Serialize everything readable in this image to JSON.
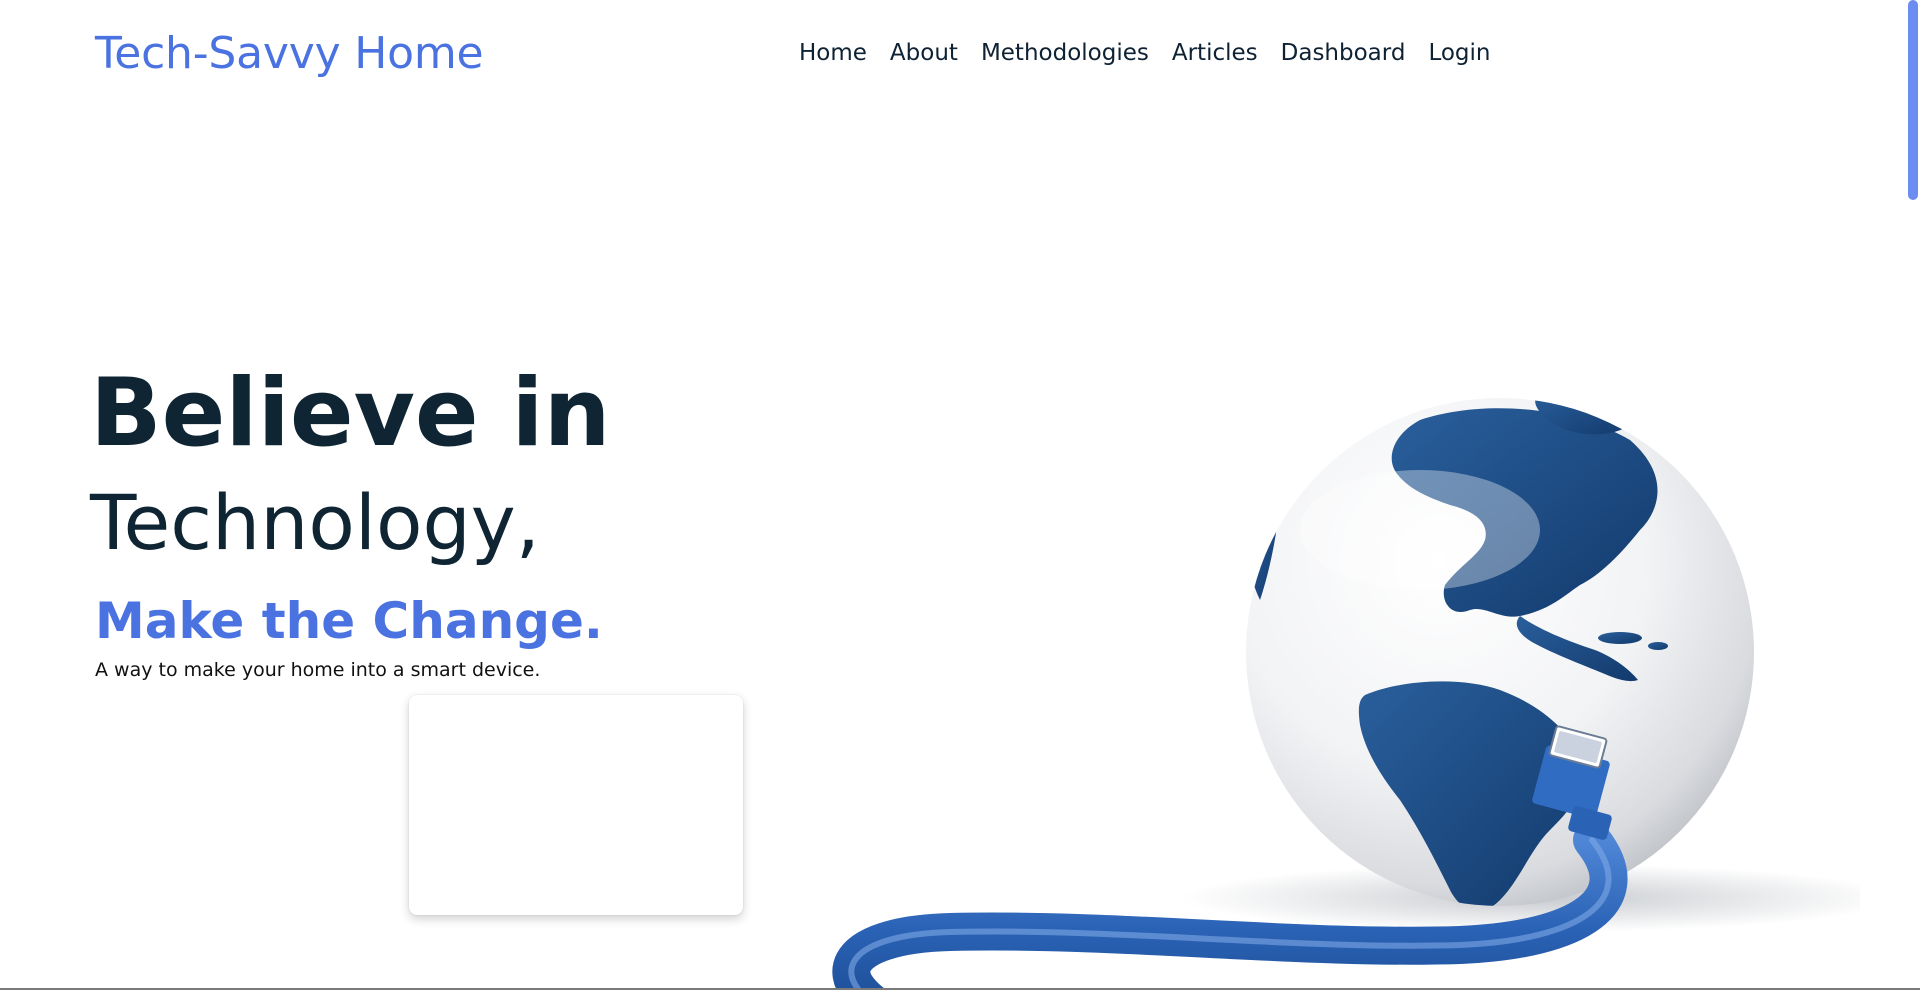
{
  "brand": {
    "title": "Tech-Savvy Home"
  },
  "nav": {
    "items": [
      {
        "label": "Home"
      },
      {
        "label": "About"
      },
      {
        "label": "Methodologies"
      },
      {
        "label": "Articles"
      },
      {
        "label": "Dashboard"
      },
      {
        "label": "Login"
      }
    ]
  },
  "hero": {
    "line1": "Believe in",
    "line2": "Technology,",
    "line3": "Make the Change.",
    "subtitle": "A way to make your home into a smart device."
  },
  "colors": {
    "accent": "#4a72e0",
    "heading": "#0f2533",
    "globe_ocean": "#f1f2f4",
    "globe_land": "#1a4e8a",
    "cable": "#2a62b5",
    "scrollbar": "#6b8cf0"
  },
  "icons": {
    "illustration": "globe-with-ethernet-cable-icon"
  }
}
